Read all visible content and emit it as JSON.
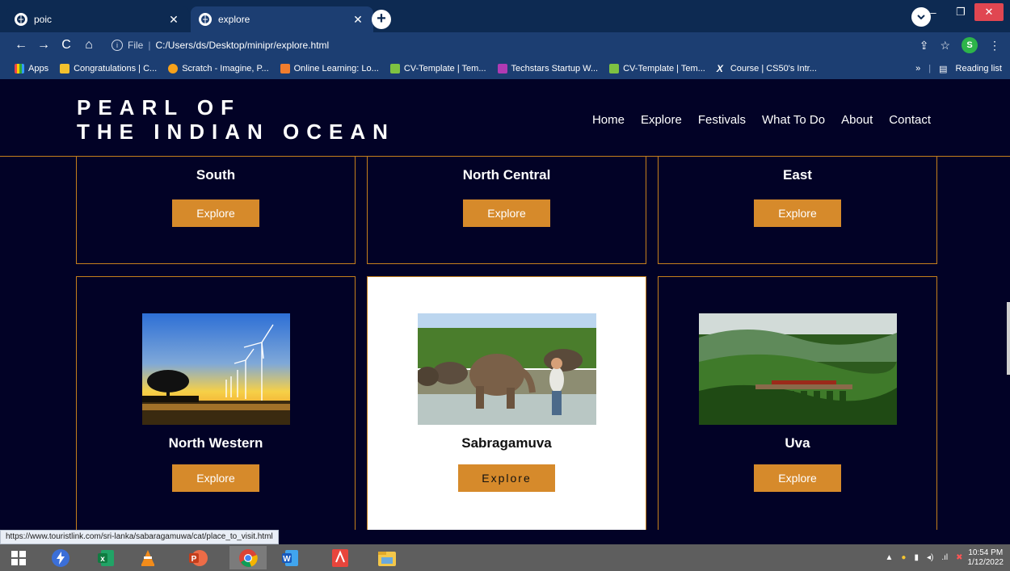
{
  "browser": {
    "tabs": [
      {
        "title": "poic",
        "active": false
      },
      {
        "title": "explore",
        "active": true
      }
    ],
    "address": {
      "scheme_label": "File",
      "url": "C:/Users/ds/Desktop/minipr/explore.html"
    },
    "profile_initial": "S",
    "bookmarks": [
      {
        "label": "Apps",
        "icon": "apps-grid-icon"
      },
      {
        "label": "Congratulations | C...",
        "icon": "bookmark-icon"
      },
      {
        "label": "Scratch - Imagine, P...",
        "icon": "scratch-icon"
      },
      {
        "label": "Online Learning: Lo...",
        "icon": "online-learning-icon"
      },
      {
        "label": "CV-Template | Tem...",
        "icon": "cv-icon"
      },
      {
        "label": "Techstars Startup W...",
        "icon": "techstars-icon"
      },
      {
        "label": "CV-Template | Tem...",
        "icon": "cv-icon"
      },
      {
        "label": "Course | CS50's Intr...",
        "icon": "edx-icon"
      }
    ],
    "overflow_label": "»",
    "reading_list_label": "Reading list",
    "status_url": "https://www.touristlink.com/sri-lanka/sabaragamuwa/cat/place_to_visit.html"
  },
  "site": {
    "logo_line1": "PEARL OF",
    "logo_line2": "THE INDIAN OCEAN",
    "nav": [
      "Home",
      "Explore",
      "Festivals",
      "What To Do",
      "About",
      "Contact"
    ],
    "provinces_top": [
      {
        "name": "South",
        "button": "Explore"
      },
      {
        "name": "North Central",
        "button": "Explore"
      },
      {
        "name": "East",
        "button": "Explore"
      }
    ],
    "provinces_bottom": [
      {
        "name": "North Western",
        "button": "Explore",
        "image": "wind turbines at sunset"
      },
      {
        "name": "Sabragamuva",
        "button": "Explore",
        "image": "elephants bathing in river",
        "hovered": true
      },
      {
        "name": "Uva",
        "button": "Explore",
        "image": "train on bridge in green hills"
      }
    ]
  },
  "taskbar": {
    "apps": [
      "windows-start-icon",
      "power-automate-icon",
      "excel-icon",
      "vlc-icon",
      "powerpoint-icon",
      "chrome-icon",
      "word-icon",
      "acrobat-icon",
      "file-explorer-icon"
    ],
    "time": "10:54 PM",
    "date": "1/12/2022"
  },
  "colors": {
    "page_bg": "#020226",
    "accent": "#d68a2b",
    "border": "#c57f1c",
    "chrome": "#1c3e72"
  }
}
